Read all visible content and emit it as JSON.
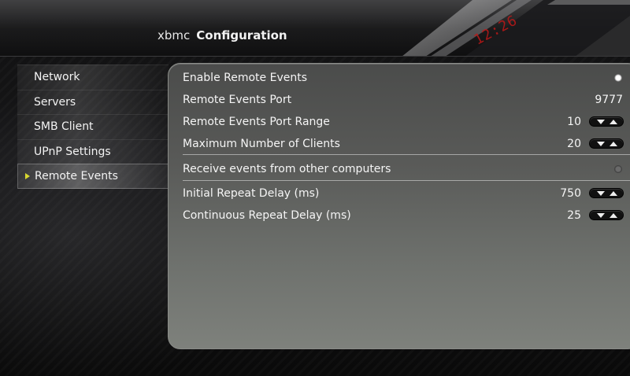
{
  "header": {
    "brand": "xbmc",
    "section": "Configuration",
    "clock": "12:26"
  },
  "sidebar": {
    "items": [
      {
        "label": "Network",
        "active": false
      },
      {
        "label": "Servers",
        "active": false
      },
      {
        "label": "SMB Client",
        "active": false
      },
      {
        "label": "UPnP Settings",
        "active": false
      },
      {
        "label": "Remote Events",
        "active": true
      }
    ]
  },
  "settings": [
    {
      "label": "Enable Remote Events",
      "control": "radio",
      "checked": true
    },
    {
      "label": "Remote Events Port",
      "control": "text",
      "value": "9777"
    },
    {
      "label": "Remote Events Port Range",
      "control": "spinner",
      "value": "10"
    },
    {
      "label": "Maximum Number of Clients",
      "control": "spinner",
      "value": "20"
    },
    {
      "label": "Receive events from other computers",
      "control": "radio",
      "checked": false
    },
    {
      "label": "Initial Repeat Delay (ms)",
      "control": "spinner",
      "value": "750"
    },
    {
      "label": "Continuous Repeat Delay (ms)",
      "control": "spinner",
      "value": "25"
    }
  ],
  "colors": {
    "accent_marker": "#d8d830",
    "clock_red": "#c01818"
  },
  "icons": {
    "spinner_down": "arrow-down-icon",
    "spinner_up": "arrow-up-icon",
    "selected_marker": "triangle-right-icon"
  }
}
